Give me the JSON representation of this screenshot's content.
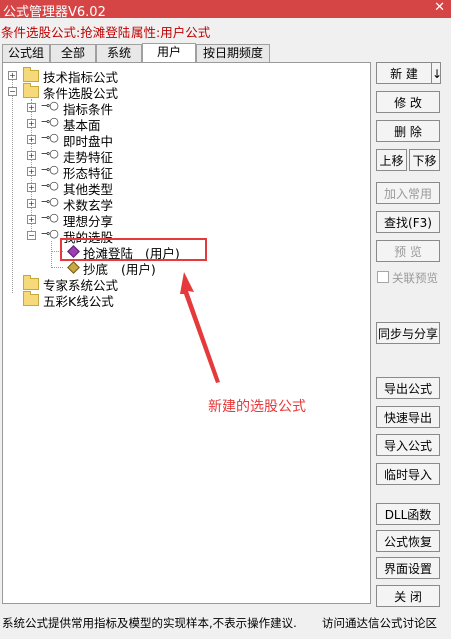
{
  "window": {
    "title": "公式管理器V6.02",
    "close_glyph": "✕"
  },
  "info": {
    "text1": "条件选股公式:抢滩登陆",
    "text2": "属性:用户公式"
  },
  "tabs": [
    "公式组",
    "全部",
    "系统",
    "用户",
    "按日期频度"
  ],
  "active_tab": "用户",
  "tree": {
    "root1": "技术指标公式",
    "root2": "条件选股公式",
    "children": [
      "指标条件",
      "基本面",
      "即时盘中",
      "走势特征",
      "形态特征",
      "其他类型",
      "术数玄学",
      "理想分享",
      "我的选股"
    ],
    "my_items": [
      {
        "name": "抢滩登陆",
        "tag": "(用户)"
      },
      {
        "name": "抄底",
        "tag": "(用户)"
      }
    ],
    "root3": "专家系统公式",
    "root4": "五彩K线公式"
  },
  "annotation": "新建的选股公式",
  "buttons": {
    "new": "新  建",
    "new_arrow": "↓",
    "edit": "修  改",
    "delete": "删  除",
    "up": "上移",
    "down": "下移",
    "add_common": "加入常用",
    "find": "查找(F3)",
    "preview": "预  览",
    "link_preview": "关联预览",
    "sync_share": "同步与分享",
    "export": "导出公式",
    "quick_export": "快速导出",
    "import": "导入公式",
    "temp_import": "临时导入",
    "dll": "DLL函数",
    "restore": "公式恢复",
    "ui_settings": "界面设置",
    "close": "关  闭"
  },
  "status": {
    "left": "系统公式提供常用指标及模型的实现样本,不表示操作建议.",
    "right": "访问通达信公式讨论区"
  },
  "colors": {
    "title_bar": "#d64545",
    "info_text": "#c00000",
    "highlight": "#e5393b"
  }
}
